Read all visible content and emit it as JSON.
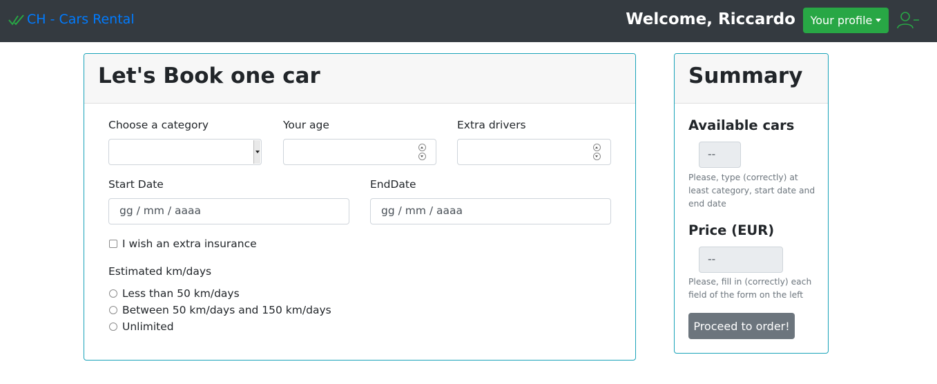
{
  "navbar": {
    "brand": "CH - Cars Rental",
    "welcome": "Welcome, Riccardo",
    "profile_button": "Your profile",
    "icons": [
      "check-double-icon",
      "caret-down-icon",
      "person-dash-icon"
    ],
    "colors": {
      "brand": "#007bff",
      "navbar_bg": "#343a40",
      "profile_button": "#28a745"
    }
  },
  "booking": {
    "title": "Let's Book one car",
    "category_label": "Choose a category",
    "category_value": "",
    "age_label": "Your age",
    "age_value": "",
    "drivers_label": "Extra drivers",
    "drivers_value": "",
    "start_label": "Start Date",
    "start_placeholder": "gg / mm / aaaa",
    "end_label": "EndDate",
    "end_placeholder": "gg / mm / aaaa",
    "insurance_label": "I wish an extra insurance",
    "km_label": "Estimated km/days",
    "km_options": [
      "Less than 50 km/days",
      "Between 50 km/days and 150 km/days",
      "Unlimited"
    ]
  },
  "summary": {
    "title": "Summary",
    "available_label": "Available cars",
    "available_value": "--",
    "available_help": "Please, type (correctly) at least category, start date and end date",
    "price_label": "Price (EUR)",
    "price_value": "--",
    "price_help": "Please, fill in (correctly) each field of the form on the left",
    "order_button": "Proceed to order!"
  }
}
